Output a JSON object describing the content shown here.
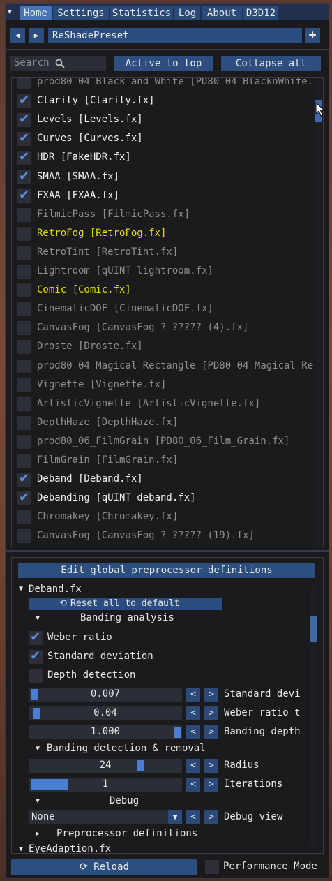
{
  "tabs": [
    "Home",
    "Settings",
    "Statistics",
    "Log",
    "About",
    "D3D12"
  ],
  "preset": {
    "name": "ReShadePreset",
    "prev": "◀",
    "next": "▶",
    "add": "+"
  },
  "search": {
    "placeholder": "Search"
  },
  "toolbar": {
    "active_to_top": "Active to top",
    "collapse_all": "Collapse all"
  },
  "effects": [
    {
      "label": "prod80_04_Black_and_White [PD80_04_BlacknWhite.",
      "checked": false,
      "style": "off"
    },
    {
      "label": "Clarity [Clarity.fx]",
      "checked": true,
      "style": "on"
    },
    {
      "label": "Levels [Levels.fx]",
      "checked": true,
      "style": "on"
    },
    {
      "label": "Curves [Curves.fx]",
      "checked": true,
      "style": "on"
    },
    {
      "label": "HDR [FakeHDR.fx]",
      "checked": true,
      "style": "on"
    },
    {
      "label": "SMAA [SMAA.fx]",
      "checked": true,
      "style": "on"
    },
    {
      "label": "FXAA [FXAA.fx]",
      "checked": true,
      "style": "on"
    },
    {
      "label": "FilmicPass [FilmicPass.fx]",
      "checked": false,
      "style": "off"
    },
    {
      "label": "RetroFog [RetroFog.fx]",
      "checked": false,
      "style": "yellow"
    },
    {
      "label": "RetroTint [RetroTint.fx]",
      "checked": false,
      "style": "off"
    },
    {
      "label": "Lightroom [qUINT_lightroom.fx]",
      "checked": false,
      "style": "off"
    },
    {
      "label": "Comic [Comic.fx]",
      "checked": false,
      "style": "yellow"
    },
    {
      "label": "CinematicDOF [CinematicDOF.fx]",
      "checked": false,
      "style": "off"
    },
    {
      "label": "CanvasFog [CanvasFog ? ????? (4).fx]",
      "checked": false,
      "style": "off"
    },
    {
      "label": "Droste [Droste.fx]",
      "checked": false,
      "style": "off"
    },
    {
      "label": "prod80_04_Magical_Rectangle [PD80_04_Magical_Re",
      "checked": false,
      "style": "off"
    },
    {
      "label": "Vignette [Vignette.fx]",
      "checked": false,
      "style": "off"
    },
    {
      "label": "ArtisticVignette [ArtisticVignette.fx]",
      "checked": false,
      "style": "off"
    },
    {
      "label": "DepthHaze [DepthHaze.fx]",
      "checked": false,
      "style": "off"
    },
    {
      "label": "prod80_06_FilmGrain [PD80_06_Film_Grain.fx]",
      "checked": false,
      "style": "off"
    },
    {
      "label": "FilmGrain [FilmGrain.fx]",
      "checked": false,
      "style": "off"
    },
    {
      "label": "Deband [Deband.fx]",
      "checked": true,
      "style": "on"
    },
    {
      "label": "Debanding [qUINT_deband.fx]",
      "checked": true,
      "style": "on"
    },
    {
      "label": "Chromakey [Chromakey.fx]",
      "checked": false,
      "style": "off"
    },
    {
      "label": "CanvasFog [CanvasFog ? ????? (19).fx]",
      "checked": false,
      "style": "off"
    }
  ],
  "settings": {
    "edit_global": "Edit global preprocessor definitions",
    "effect_name": "Deband.fx",
    "reset_all": "Reset all to default",
    "banding_analysis": "Banding analysis",
    "weber_ratio": "Weber ratio",
    "standard_deviation": "Standard deviation",
    "depth_detection": "Depth detection",
    "sliders": [
      {
        "value": "0.007",
        "label": "Standard devi",
        "fill": 0.03
      },
      {
        "value": "0.04",
        "label": "Weber ratio t",
        "fill": 0.04
      },
      {
        "value": "1.000",
        "label": "Banding depth",
        "fill": 1.0
      }
    ],
    "banding_detection": "Banding detection & removal",
    "radius": {
      "value": "24",
      "label": "Radius"
    },
    "iterations": {
      "value": "1",
      "label": "Iterations"
    },
    "debug": "Debug",
    "debug_view": {
      "value": "None",
      "label": "Debug view"
    },
    "preprocessor": "Preprocessor definitions",
    "next_effect": "EyeAdaption.fx",
    "arrow_left": "<",
    "arrow_right": ">"
  },
  "footer": {
    "reload": "Reload",
    "performance_mode": "Performance Mode"
  }
}
